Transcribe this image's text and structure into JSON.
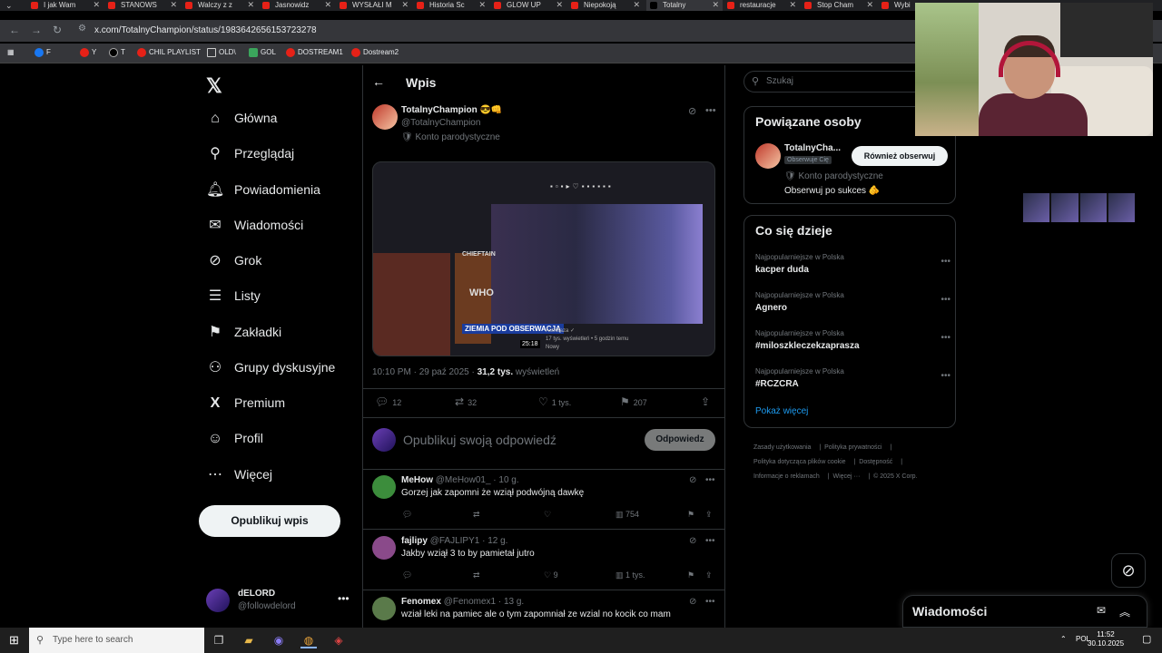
{
  "browser": {
    "tabs": [
      {
        "label": "I jak Wam"
      },
      {
        "label": "STANOWS"
      },
      {
        "label": "Walczy z z"
      },
      {
        "label": "Jasnowidz"
      },
      {
        "label": "WYSŁAŁI M"
      },
      {
        "label": "Historia Sc"
      },
      {
        "label": "GLOW UP"
      },
      {
        "label": "Niepokoją"
      },
      {
        "label": "Totalny"
      },
      {
        "label": "restauracje"
      },
      {
        "label": "Stop Cham"
      },
      {
        "label": "Wybi"
      }
    ],
    "url": "x.com/TotalnyChampion/status/1983642656153723278",
    "bookmarks": [
      {
        "label": "F"
      },
      {
        "label": "Y"
      },
      {
        "label": "T"
      },
      {
        "label": "CHIL PLAYLIST"
      },
      {
        "label": "OLD\\"
      },
      {
        "label": "GOL"
      },
      {
        "label": "DOSTREAM1"
      },
      {
        "label": "Dostream2"
      }
    ]
  },
  "nav": {
    "items": [
      {
        "label": "Główna",
        "icon": "⌂"
      },
      {
        "label": "Przeglądaj",
        "icon": "⚲"
      },
      {
        "label": "Powiadomienia",
        "icon": "🔔︎"
      },
      {
        "label": "Wiadomości",
        "icon": "✉"
      },
      {
        "label": "Grok",
        "icon": "⊘"
      },
      {
        "label": "Listy",
        "icon": "☰"
      },
      {
        "label": "Zakładki",
        "icon": "⚑"
      },
      {
        "label": "Grupy dyskusyjne",
        "icon": "⚇"
      },
      {
        "label": "Premium",
        "icon": "X"
      },
      {
        "label": "Profil",
        "icon": "☺"
      },
      {
        "label": "Więcej",
        "icon": "⋯"
      }
    ],
    "post_button": "Opublikuj wpis",
    "me": {
      "name": "dELORD",
      "handle": "@followdelord"
    }
  },
  "main": {
    "title": "Wpis",
    "post": {
      "name": "TotalnyChampion 😎👊",
      "handle": "@TotalnyChampion",
      "label": "🛡 Konto parodystyczne",
      "media": {
        "overlay1": "CHIEFTAIN",
        "overlay2": "WHO",
        "overlay3": "ZIEMIA POD OBSERWACJĄ",
        "duration": "25:18",
        "channel": "Astrofaza ✓",
        "meta": "17 tys. wyświetleń • 5 godzin temu",
        "badge": "Nowy"
      },
      "time": "10:10 PM · 29 paź 2025 · ",
      "views": "31,2 tys.",
      "views_label": " wyświetleń",
      "replies": "12",
      "reposts": "32",
      "likes": "1 tys.",
      "bookmarks": "207"
    },
    "reply_placeholder": "Opublikuj swoją odpowiedź",
    "reply_button": "Odpowiedz",
    "comments": [
      {
        "name": "MeHow",
        "handle": "@MeHow01_ · 10 g.",
        "text": "Gorzej jak zapomni że wziął podwójną dawkę",
        "likes": "",
        "views": "754",
        "avatar": "#3c8d3c"
      },
      {
        "name": "fajlipy",
        "handle": "@FAJLIPY1 · 12 g.",
        "text": "Jakby wziął 3 to by pamietał jutro",
        "likes": "9",
        "views": "1 tys.",
        "avatar": "#8a4a8a"
      },
      {
        "name": "Fenomex",
        "handle": "@Fenomex1 · 13 g.",
        "text": "wział leki na pamiec ale o tym zapomniał ze wzial no kocik co mam",
        "likes": "",
        "views": "",
        "avatar": "#5a7a4a"
      }
    ]
  },
  "right": {
    "search_placeholder": "Szukaj",
    "related": {
      "title": "Powiązane osoby",
      "name": "TotalnyCha...",
      "badge": "Obserwuje Cię",
      "follow": "Również obserwuj",
      "label": "🛡 Konto parodystyczne",
      "bio": "Obserwuj po sukces 🫵"
    },
    "trends": {
      "title": "Co się dzieje",
      "items": [
        {
          "context": "Najpopularniejsze w Polska",
          "name": "kacper duda"
        },
        {
          "context": "Najpopularniejsze w Polska",
          "name": "Agnero"
        },
        {
          "context": "Najpopularniejsze w Polska",
          "name": "#miloszkleczekzaprasza"
        },
        {
          "context": "Najpopularniejsze w Polska",
          "name": "#RCZCRA"
        }
      ],
      "show_more": "Pokaż więcej"
    },
    "footer": [
      "Zasady użytkowania",
      "Polityka prywatności",
      "Polityka dotycząca plików cookie",
      "Dostępność",
      "Informacje o reklamach",
      "Więcej ···",
      "© 2025 X Corp."
    ]
  },
  "dm": {
    "title": "Wiadomości"
  },
  "taskbar": {
    "search": "Type here to search",
    "lang": "POL",
    "time": "11:52",
    "date": "30.10.2025"
  }
}
